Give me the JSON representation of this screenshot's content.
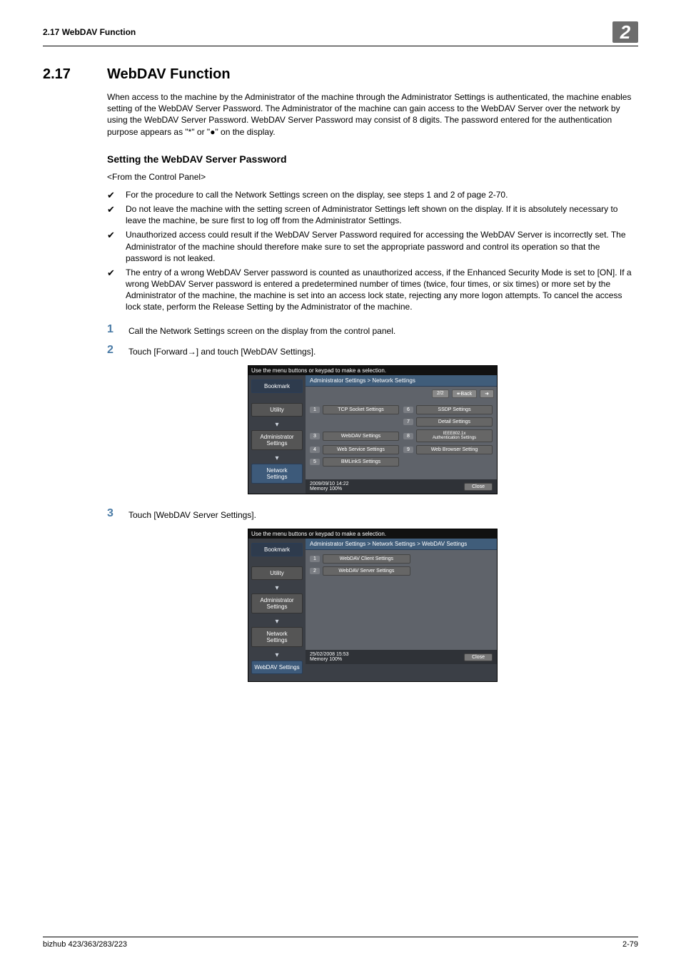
{
  "header": {
    "left": "2.17    WebDAV Function",
    "chapter_num": "2"
  },
  "section": {
    "number": "2.17",
    "title": "WebDAV Function"
  },
  "intro": "When access to the machine by the Administrator of the machine through the Administrator Settings is authenticated, the machine enables setting of the WebDAV Server Password. The Administrator of the machine can gain access to the WebDAV Server over the network by using the WebDAV Server Password. WebDAV Server Password may consist of 8 digits. The password entered for the authentication purpose appears as \"*\" or \"●\" on the display.",
  "subhead": "Setting the WebDAV Server Password",
  "fromcp": "<From the Control Panel>",
  "bullets": [
    "For the procedure to call the Network Settings screen on the display, see steps 1 and 2 of page 2-70.",
    "Do not leave the machine with the setting screen of Administrator Settings left shown on the display. If it is absolutely necessary to leave the machine, be sure first to log off from the Administrator Settings.",
    "Unauthorized access could result if the WebDAV Server Password required for accessing the WebDAV Server is incorrectly set. The Administrator of the machine should therefore make sure to set the appropriate password and control its operation so that the password is not leaked.",
    "The entry of a wrong WebDAV Server password is counted as unauthorized access, if the Enhanced Security Mode is set to [ON]. If a wrong WebDAV Server password is entered a predetermined number of times (twice, four times, or six times) or more set by the Administrator of the machine, the machine is set into an access lock state, rejecting any more logon attempts. To cancel the access lock state, perform the Release Setting by the Administrator of the machine."
  ],
  "steps": [
    {
      "n": "1",
      "t": "Call the Network Settings screen on the display from the control panel."
    },
    {
      "n": "2",
      "t": "Touch [Forward→] and touch [WebDAV Settings]."
    },
    {
      "n": "3",
      "t": "Touch [WebDAV Server Settings]."
    }
  ],
  "shot1": {
    "top": "Use the menu buttons or keypad to make a selection.",
    "side": {
      "bookmark": "Bookmark",
      "utility": "Utility",
      "admin": "Administrator\nSettings",
      "net": "Network\nSettings"
    },
    "crumb": "Administrator Settings > Network Settings",
    "nav": {
      "page": "2/2",
      "back": "↞Back",
      "fwd": "➜"
    },
    "cells": {
      "c1n": "1",
      "c1": "TCP Socket Settings",
      "c6n": "6",
      "c6": "SSDP Settings",
      "c7n": "7",
      "c7": "Detail Settings",
      "c3n": "3",
      "c3": "WebDAV Settings",
      "c8n": "8",
      "c8": "IEEE802.1x\nAuthentication Settings",
      "c4n": "4",
      "c4": "Web Service Settings",
      "c9n": "9",
      "c9": "Web Browser Setting",
      "c5n": "5",
      "c5": "BMLinkS Settings"
    },
    "foot": {
      "dt": "2009/09/10   14:22",
      "mem": "Memory        100%",
      "close": "Close"
    }
  },
  "shot2": {
    "top": "Use the menu buttons or keypad to make a selection.",
    "side": {
      "bookmark": "Bookmark",
      "utility": "Utility",
      "admin": "Administrator\nSettings",
      "net": "Network\nSettings",
      "webdav": "WebDAV Settings"
    },
    "crumb": "Administrator Settings > Network Settings > WebDAV Settings",
    "cells": {
      "c1n": "1",
      "c1": "WebDAV Client Settings",
      "c2n": "2",
      "c2": "WebDAV Server Settings"
    },
    "foot": {
      "dt": "25/02/2008   15:53",
      "mem": "Memory        100%",
      "close": "Close"
    }
  },
  "footer": {
    "left": "bizhub 423/363/283/223",
    "right": "2-79"
  }
}
